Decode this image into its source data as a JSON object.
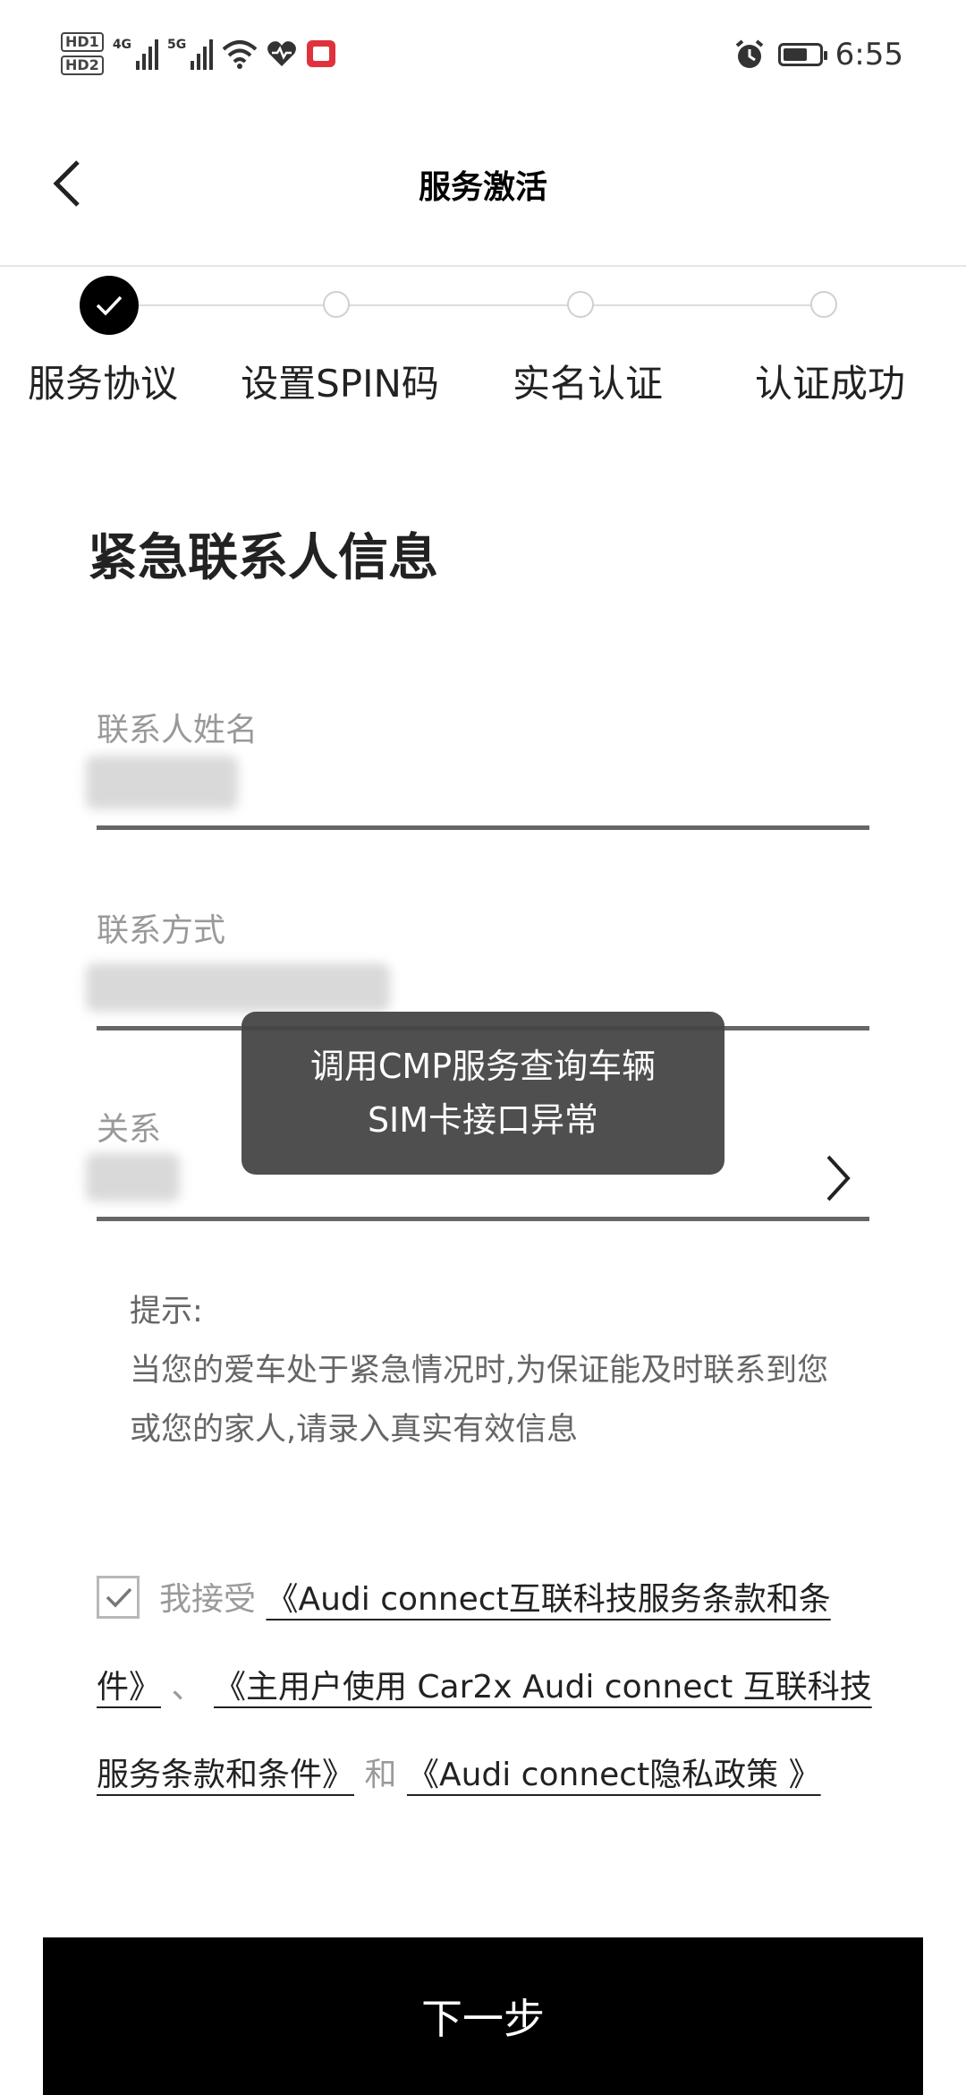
{
  "status_bar": {
    "time": "6:55",
    "hd1": "HD1",
    "hd2": "HD2",
    "net1": "4G",
    "net2": "5G",
    "icons": [
      "wifi-icon",
      "heartbeat-icon",
      "notification-icon",
      "alarm-icon",
      "battery-icon"
    ]
  },
  "header": {
    "title": "服务激活"
  },
  "steps": [
    {
      "label": "服务协议",
      "state": "done"
    },
    {
      "label": "设置SPIN码",
      "state": "todo"
    },
    {
      "label": "实名认证",
      "state": "todo"
    },
    {
      "label": "认证成功",
      "state": "todo"
    }
  ],
  "form": {
    "section_title": "紧急联系人信息",
    "name_label": "联系人姓名",
    "phone_label": "联系方式",
    "relation_label": "关系"
  },
  "toast": {
    "line1": "调用CMP服务查询车辆",
    "line2": "SIM卡接口异常"
  },
  "tips": {
    "heading": "提示:",
    "body": "当您的爱车处于紧急情况时,为保证能及时联系到您或您的家人,请录入真实有效信息"
  },
  "agreement": {
    "accept_text": "我接受",
    "link1": "《Audi connect互联科技服务条款和条件》",
    "separator": "、",
    "link2": "《主用户使用 Car2x Audi connect 互联科技服务条款和条件》",
    "and_text": "和",
    "link3": "《Audi connect隐私政策 》",
    "checked": true
  },
  "next_button": {
    "label": "下一步"
  },
  "colors": {
    "primary": "#000000",
    "label_gray": "#999999",
    "toast_bg": "#464646"
  }
}
